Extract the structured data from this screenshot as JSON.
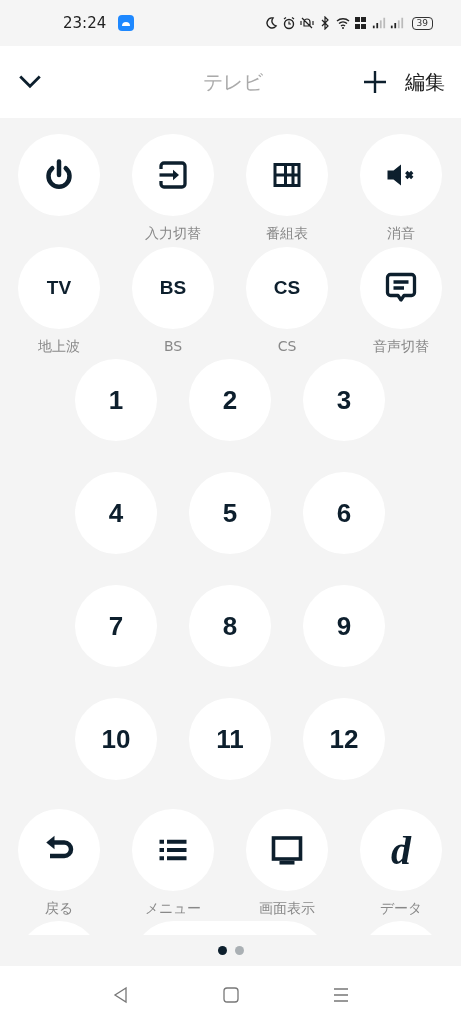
{
  "status_bar": {
    "time": "23:24",
    "battery": "39"
  },
  "header": {
    "title": "テレビ",
    "edit": "編集"
  },
  "top_buttons": [
    {
      "kind": "icon"
    },
    {
      "kind": "icon",
      "label": "入力切替"
    },
    {
      "kind": "icon",
      "label": "番組表"
    },
    {
      "kind": "icon",
      "label": "消音"
    },
    {
      "kind": "text",
      "glyph": "TV",
      "label": "地上波"
    },
    {
      "kind": "text",
      "glyph": "BS",
      "label": "BS"
    },
    {
      "kind": "text",
      "glyph": "CS",
      "label": "CS"
    },
    {
      "kind": "icon",
      "label": "音声切替"
    }
  ],
  "number_pad": [
    "1",
    "2",
    "3",
    "4",
    "5",
    "6",
    "7",
    "8",
    "9",
    "10",
    "11",
    "12"
  ],
  "bottom_buttons": [
    {
      "kind": "icon",
      "label": "戻る"
    },
    {
      "kind": "icon",
      "label": "メニュー"
    },
    {
      "kind": "icon",
      "label": "画面表示"
    },
    {
      "kind": "logo",
      "glyph": "d",
      "label": "データ"
    }
  ],
  "partial_row": [
    {
      "kind": "round"
    },
    {
      "kind": "wide"
    },
    {
      "kind": "round"
    }
  ],
  "pager": [
    {
      "selected": true
    },
    {
      "selected": false
    }
  ]
}
